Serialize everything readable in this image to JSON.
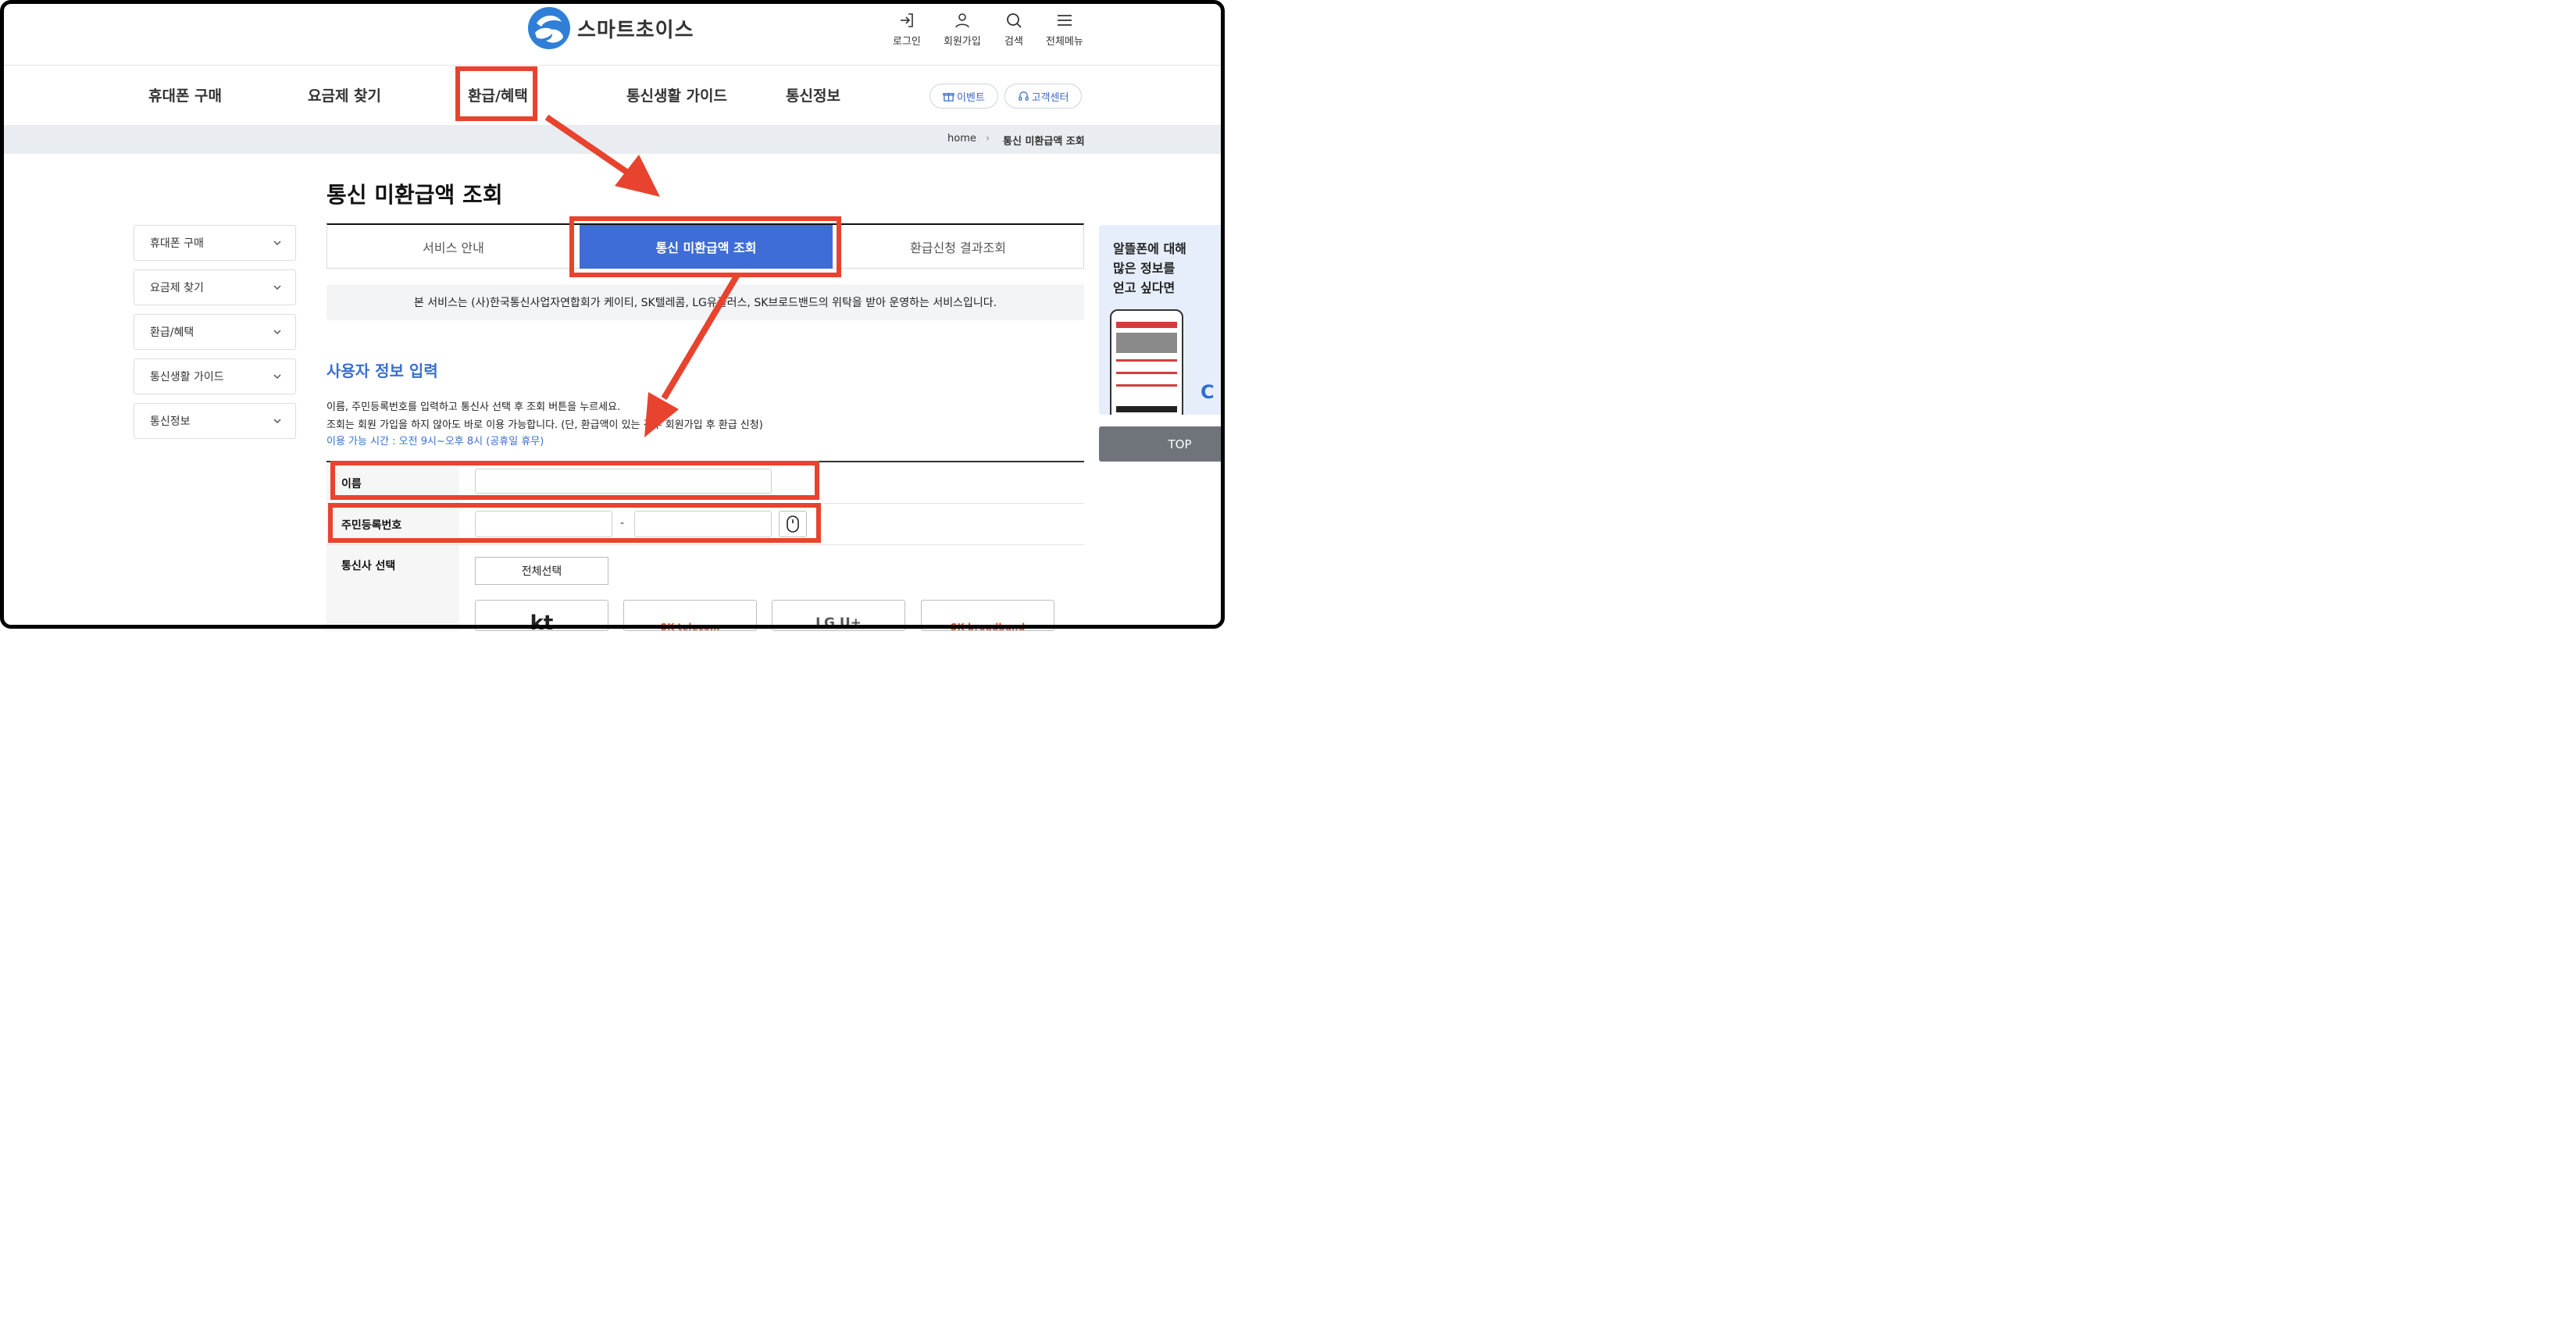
{
  "header": {
    "logo_text": "스마트초이스",
    "util": [
      {
        "label": "로그인",
        "icon": "login-icon"
      },
      {
        "label": "회원가입",
        "icon": "user-icon"
      },
      {
        "label": "검색",
        "icon": "search-icon"
      },
      {
        "label": "전체메뉴",
        "icon": "menu-icon"
      }
    ]
  },
  "nav": {
    "items": [
      "휴대폰 구매",
      "요금제 찾기",
      "환급/혜택",
      "통신생활 가이드",
      "통신정보"
    ],
    "event_label": "이벤트",
    "support_label": "고객센터"
  },
  "breadcrumb": {
    "home": "home",
    "current": "통신 미환급액 조회"
  },
  "page_title": "통신 미환급액 조회",
  "sidebar": {
    "items": [
      "휴대폰 구매",
      "요금제 찾기",
      "환급/혜택",
      "통신생활 가이드",
      "통신정보"
    ]
  },
  "tabs": [
    {
      "label": "서비스 안내",
      "active": false
    },
    {
      "label": "통신 미환급액 조회",
      "active": true
    },
    {
      "label": "환급신청 결과조회",
      "active": false
    }
  ],
  "notice": "본 서비스는 (사)한국통신사업자연합회가 케이티, SK텔레콤, LG유플러스, SK브로드밴드의 위탁을 받아 운영하는 서비스입니다.",
  "section": {
    "title": "사용자 정보 입력",
    "desc1": "이름, 주민등록번호를 입력하고 통신사 선택 후 조회 버튼을 누르세요.",
    "desc2": "조회는 회원 가입을 하지 않아도 바로 이용 가능합니다. (단, 환급액이 있는 경우 회원가입 후 환급 신청)",
    "hours": "이용 가능 시간 : 오전 9시~오후 8시 (공휴일 휴무)"
  },
  "form": {
    "name_label": "이름",
    "name_value": "",
    "rrn_label": "주민등록번호",
    "rrn_front": "",
    "rrn_back": "",
    "rrn_dash": "-",
    "carrier_label": "통신사 선택",
    "select_all_label": "전체선택",
    "carriers": [
      "kt",
      "SK telecom",
      "LG U+",
      "SK broadband"
    ]
  },
  "side_widget": {
    "ad_text": "알뜰폰에 대해\n많은 정보를\n얻고 싶다면",
    "top_label": "TOP"
  },
  "colors": {
    "accent": "#3f6cd6",
    "annotation": "#e8432e",
    "link_blue": "#3a6fd0"
  }
}
